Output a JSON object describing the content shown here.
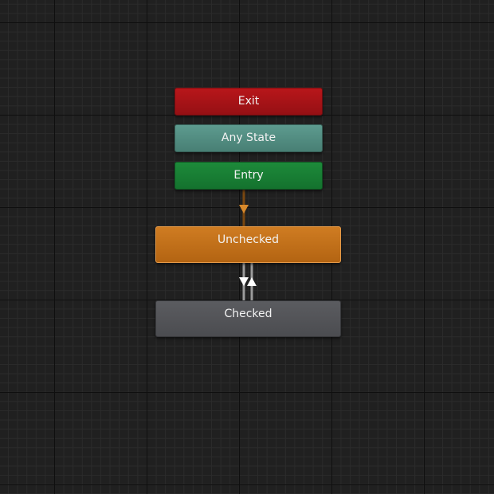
{
  "graph": {
    "nodes": {
      "exit": {
        "label": "Exit",
        "color": "#a81317"
      },
      "any_state": {
        "label": "Any State",
        "color": "#528d82"
      },
      "entry": {
        "label": "Entry",
        "color": "#187e34"
      },
      "unchecked": {
        "label": "Unchecked",
        "color": "#c26f1a",
        "is_default": true
      },
      "checked": {
        "label": "Checked",
        "color": "#535458"
      }
    },
    "transitions": [
      {
        "from": "Entry",
        "to": "Unchecked",
        "color": "#9a5a12"
      },
      {
        "from": "Unchecked",
        "to": "Checked",
        "color": "#ffffff"
      },
      {
        "from": "Checked",
        "to": "Unchecked",
        "color": "#ffffff"
      }
    ]
  }
}
